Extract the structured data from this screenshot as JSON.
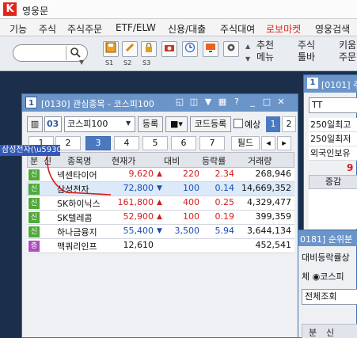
{
  "app": {
    "title": "영웅문",
    "icon_letter": "K"
  },
  "menubar": {
    "items": [
      "기능",
      "주식",
      "주식주문",
      "ETF/ELW",
      "신용/대출",
      "주식대여",
      "로보마켓",
      "영웅검색"
    ],
    "highlight_color": "#d8261b"
  },
  "toolbar": {
    "search_placeholder": "",
    "search_icon": "search-icon",
    "screen_captions": [
      "S1",
      "S2",
      "S3"
    ],
    "groups": [
      {
        "line1": "추천",
        "line2": "메뉴"
      },
      {
        "line1": "주식",
        "line2": "툴바"
      },
      {
        "line1": "키움",
        "line2": "주문"
      }
    ]
  },
  "main_window": {
    "number": "1",
    "title": "[0130] 관심종목 - 코스피100",
    "group_code": "03",
    "group_name": "코스피100",
    "register_button": "등록",
    "code_register_button": "코드등록",
    "expected_label": "예상",
    "page_buttons": [
      "1",
      "2"
    ],
    "field_button": "필드",
    "tabs": [
      "1",
      "2",
      "3",
      "4",
      "5",
      "6",
      "7"
    ],
    "active_tab": "3",
    "columns": [
      "분",
      "신",
      "종목명",
      "현재가",
      "대비",
      "등락률",
      "거래량"
    ],
    "rows": [
      {
        "badge": "신",
        "badge_color": "#4faa3a",
        "name": "넥센타이어",
        "price": "9,620",
        "direction": "up",
        "change": "220",
        "rate": "2.34",
        "volume": "268,946"
      },
      {
        "badge": "신",
        "badge_color": "#4faa3a",
        "name": "삼성전자",
        "price": "72,800",
        "direction": "down",
        "change": "100",
        "rate": "0.14",
        "volume": "14,669,352"
      },
      {
        "badge": "신",
        "badge_color": "#4faa3a",
        "name": "SK하이닉스",
        "price": "161,800",
        "direction": "up",
        "change": "400",
        "rate": "0.25",
        "volume": "4,329,477"
      },
      {
        "badge": "신",
        "badge_color": "#4faa3a",
        "name": "SK텔레콤",
        "price": "52,900",
        "direction": "up",
        "change": "100",
        "rate": "0.19",
        "volume": "399,359"
      },
      {
        "badge": "신",
        "badge_color": "#4faa3a",
        "name": "하나금융지",
        "price": "55,400",
        "direction": "down",
        "change": "3,500",
        "rate": "5.94",
        "volume": "3,644,134"
      },
      {
        "badge": "증",
        "badge_color": "#b04cc0",
        "name": "맥쿼리인프",
        "price": "12,610",
        "direction": "none",
        "change": "",
        "rate": "",
        "volume": "452,541"
      }
    ]
  },
  "right_window_1": {
    "number": "1",
    "title": "[0101] 주",
    "input_value": "TT",
    "lines": [
      "250일최고",
      "250일최저",
      "외국인보유"
    ],
    "value_fragment": "9",
    "column_header": "증감"
  },
  "right_window_2": {
    "title": "0181] 순위분",
    "line1": "대비등락률상",
    "radio_label": "체 ◉코스피",
    "select_value": "전체조회",
    "columns": [
      "분",
      "신"
    ]
  },
  "drag_hint": {
    "label": "삼성전자(\\u5930)"
  }
}
